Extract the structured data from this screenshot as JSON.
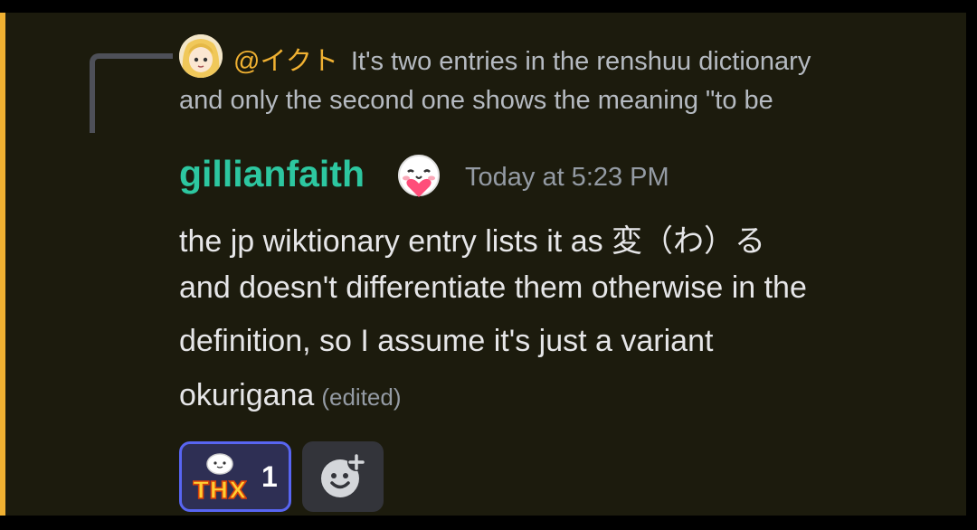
{
  "reply": {
    "author": "@イクト",
    "text_line1": "It's two entries in the renshuu dictionary",
    "text_line2": "and only the second one shows the meaning \"to be"
  },
  "message": {
    "author": "gillianfaith",
    "timestamp": "Today at 5:23 PM",
    "lines": [
      "the jp wiktionary entry lists it as 変（わ）る",
      "and doesn't differentiate them otherwise in the",
      "definition, so I assume it's just a variant",
      "okurigana"
    ],
    "edited_label": "(edited)"
  },
  "reactions": [
    {
      "emoji_name": "thx-emoji",
      "emoji_text": "THX",
      "count": "1"
    }
  ],
  "icons": {
    "reply_avatar": "anime-girl-avatar",
    "author_badge": "heart-blob-emoji",
    "add_reaction": "add-reaction-icon"
  },
  "colors": {
    "accent_bar": "#f0b132",
    "author_name": "#2dc7a0",
    "reply_author": "#f0b132",
    "reaction_border": "#5865f2"
  }
}
